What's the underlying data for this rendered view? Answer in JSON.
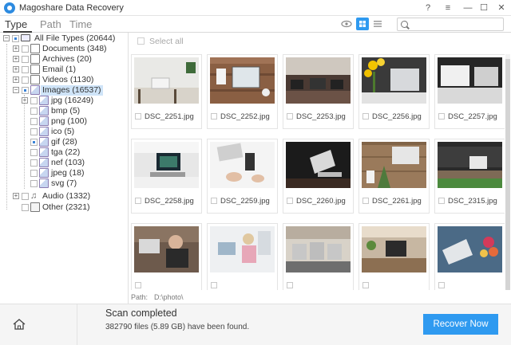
{
  "window": {
    "title": "Magoshare Data Recovery",
    "controls": {
      "help": "?",
      "menu": "≡",
      "minimize": "—",
      "maximize": "☐",
      "close": "✕"
    }
  },
  "nav": {
    "tabs": [
      {
        "label": "Type",
        "active": true
      },
      {
        "label": "Path",
        "active": false
      },
      {
        "label": "Time",
        "active": false
      }
    ],
    "view_modes": [
      "eye-icon",
      "grid-view-icon",
      "list-view-icon"
    ],
    "active_view": "grid-view-icon",
    "search": {
      "placeholder": "",
      "value": ""
    }
  },
  "sidebar": {
    "root": {
      "label": "All File Types (20644)"
    },
    "items": [
      {
        "label": "Documents (348)",
        "icon": "document-icon"
      },
      {
        "label": "Archives (20)",
        "icon": "archive-icon"
      },
      {
        "label": "Email (1)",
        "icon": "email-icon"
      },
      {
        "label": "Videos (1130)",
        "icon": "video-icon"
      },
      {
        "label": "Images (16537)",
        "icon": "image-folder-icon",
        "expanded": true,
        "children": [
          {
            "label": "jpg (16249)"
          },
          {
            "label": "bmp (5)"
          },
          {
            "label": "png (100)"
          },
          {
            "label": "ico (5)"
          },
          {
            "label": "gif (28)"
          },
          {
            "label": "tga (22)"
          },
          {
            "label": "nef (103)"
          },
          {
            "label": "jpeg (18)"
          },
          {
            "label": "svg (7)"
          }
        ]
      },
      {
        "label": "Audio (1332)",
        "icon": "audio-icon"
      },
      {
        "label": "Other (2321)",
        "icon": "other-icon"
      }
    ]
  },
  "main": {
    "select_all_label": "Select all",
    "files": [
      {
        "name": "DSC_2251.jpg"
      },
      {
        "name": "DSC_2252.jpg"
      },
      {
        "name": "DSC_2253.jpg"
      },
      {
        "name": "DSC_2256.jpg"
      },
      {
        "name": "DSC_2257.jpg"
      },
      {
        "name": "DSC_2258.jpg"
      },
      {
        "name": "DSC_2259.jpg"
      },
      {
        "name": "DSC_2260.jpg"
      },
      {
        "name": "DSC_2261.jpg"
      },
      {
        "name": "DSC_2315.jpg"
      },
      {
        "name": ""
      },
      {
        "name": ""
      },
      {
        "name": ""
      },
      {
        "name": ""
      },
      {
        "name": ""
      }
    ],
    "path_label": "Path:",
    "path_value": "D:\\photo\\"
  },
  "status": {
    "title": "Scan completed",
    "detail": "382790 files (5.89 GB) have been found."
  },
  "actions": {
    "recover_label": "Recover Now"
  },
  "colors": {
    "accent": "#2f9af0",
    "selection": "#cfe4f8"
  }
}
